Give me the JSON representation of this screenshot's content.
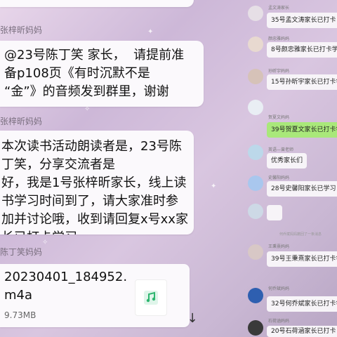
{
  "left": {
    "messages": [
      {
        "sender": "张梓昕妈妈",
        "text": "@23号陈丁笑 家长，  请提前准\n备p108页《有时沉默不是\n“金”》的音频发到群里，谢谢"
      },
      {
        "sender": "张梓昕妈妈",
        "text": "本次读书活动朗读者是，23号陈\n丁笑，分享交流者是\n好，我是1号张梓昕家长，线上读\n书学习时间到了，请大家准时参\n加并讨论哦，收到请回复x号xx家\n长已打卡学习"
      },
      {
        "sender": "陈丁笑妈妈",
        "file_name": "20230401_184952.\nm4a",
        "file_size": "9.73MB"
      }
    ],
    "download_icon": "arrow-down-icon"
  },
  "right": {
    "items": [
      {
        "name": "孟文涛家长",
        "text": "35号孟文涛家长已打卡"
      },
      {
        "name": "颜忠雅妈妈",
        "text": "8号颜忠雅家长已打卡学"
      },
      {
        "name": "孙昕宇妈妈",
        "text": "15号孙昕宇家长已打卡学"
      },
      {
        "name": "贺夏文妈妈",
        "text": "39号贺夏文家长已打卡学",
        "green": true
      },
      {
        "name": "英语—曾老师",
        "text": "优秀家长们"
      },
      {
        "name": "史馨阳妈妈",
        "text": "28号史馨阳家长已学习"
      },
      {
        "name": "王秉熹妈妈",
        "text": "39号王秉熹家长已打卡学"
      },
      {
        "name": "何乔斌妈妈",
        "text": "32号何乔斌家长已打卡学"
      },
      {
        "name": "石荷涵妈妈",
        "text": "20号石荷涵家长已打卡"
      }
    ],
    "system_note": "何乔斌妈妈撤回了一条消息"
  }
}
